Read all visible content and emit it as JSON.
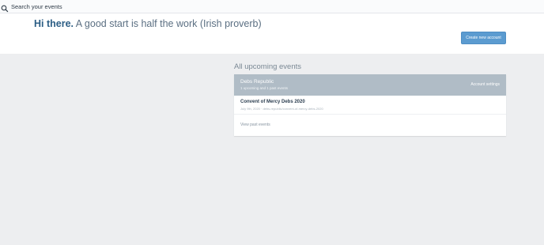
{
  "search": {
    "placeholder": "Search your events",
    "icon": "search-icon"
  },
  "hero": {
    "greeting_bold": "Hi there.",
    "greeting_rest": " A good start is half the work (Irish proverb)",
    "create_button_label": "Create new account"
  },
  "events": {
    "heading": "All upcoming events",
    "organization": {
      "name": "Debs Republic",
      "summary": "1 upcoming and 1 past events",
      "settings_label": "Account settings"
    },
    "items": [
      {
        "title": "Convent of Mercy Debs 2020",
        "meta": "July 9th, 2020 · debs-republic/convent-of-mercy-debs-2020"
      }
    ],
    "view_past_label": "View past events"
  },
  "colors": {
    "page_background": "#edeef0",
    "brand_blue": "#2c5e85",
    "primary_button": "#5b9bd0",
    "card_header": "#b0bcc6"
  }
}
